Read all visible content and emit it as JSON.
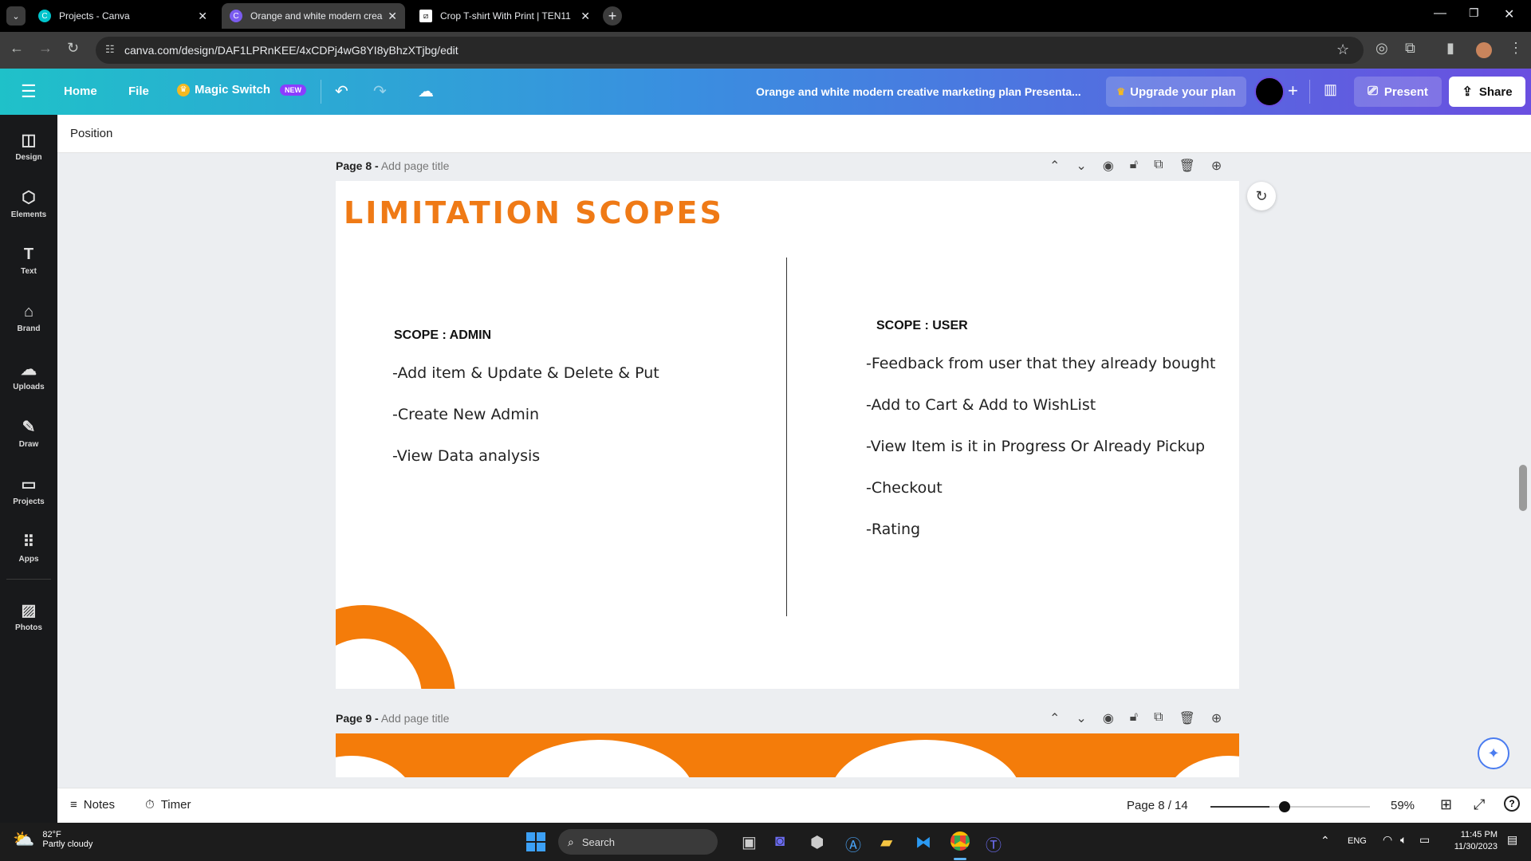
{
  "browser": {
    "tabs": [
      {
        "title": "Projects - Canva",
        "active": false
      },
      {
        "title": "Orange and white modern crea",
        "active": true
      },
      {
        "title": "Crop T-shirt With Print | TEN11",
        "active": false
      }
    ],
    "url": "canva.com/design/DAF1LPRnKEE/4xCDPj4wG8YI8yBhzXTjbg/edit"
  },
  "header": {
    "home": "Home",
    "file": "File",
    "magic_switch": "Magic Switch",
    "new_badge": "NEW",
    "doc_title": "Orange and white modern creative marketing plan Presenta...",
    "upgrade": "Upgrade your plan",
    "present": "Present",
    "share": "Share"
  },
  "sidebar": {
    "items": [
      {
        "label": "Design",
        "icon": "design-icon"
      },
      {
        "label": "Elements",
        "icon": "elements-icon"
      },
      {
        "label": "Text",
        "icon": "text-icon"
      },
      {
        "label": "Brand",
        "icon": "brand-icon"
      },
      {
        "label": "Uploads",
        "icon": "uploads-icon"
      },
      {
        "label": "Draw",
        "icon": "draw-icon"
      },
      {
        "label": "Projects",
        "icon": "projects-icon"
      },
      {
        "label": "Apps",
        "icon": "apps-icon"
      },
      {
        "label": "Photos",
        "icon": "photos-icon"
      }
    ]
  },
  "toolbar": {
    "position": "Position"
  },
  "page8": {
    "label": "Page 8 -",
    "title_placeholder": "Add page title",
    "heading": "LIMITATION SCOPES",
    "admin_heading": "SCOPE : ADMIN",
    "admin_items": [
      "-Add item & Update & Delete & Put",
      "-Create New Admin",
      "-View Data analysis"
    ],
    "user_heading": "SCOPE : USER",
    "user_items": [
      "-Feedback from user that they already bought",
      "-Add to Cart & Add to WishList",
      "-View Item is it in Progress Or Already Pickup",
      "-Checkout",
      "-Rating"
    ]
  },
  "page9": {
    "label": "Page 9 -",
    "title_placeholder": "Add page title"
  },
  "bottom": {
    "notes": "Notes",
    "timer": "Timer",
    "page_indicator": "Page 8 / 14",
    "zoom": "59%"
  },
  "taskbar": {
    "temp": "82°F",
    "weather": "Partly cloudy",
    "search": "Search",
    "lang": "ENG",
    "time": "11:45 PM",
    "date": "11/30/2023"
  },
  "colors": {
    "accent_orange": "#f47c0a",
    "heading_orange": "#ef7a16"
  }
}
